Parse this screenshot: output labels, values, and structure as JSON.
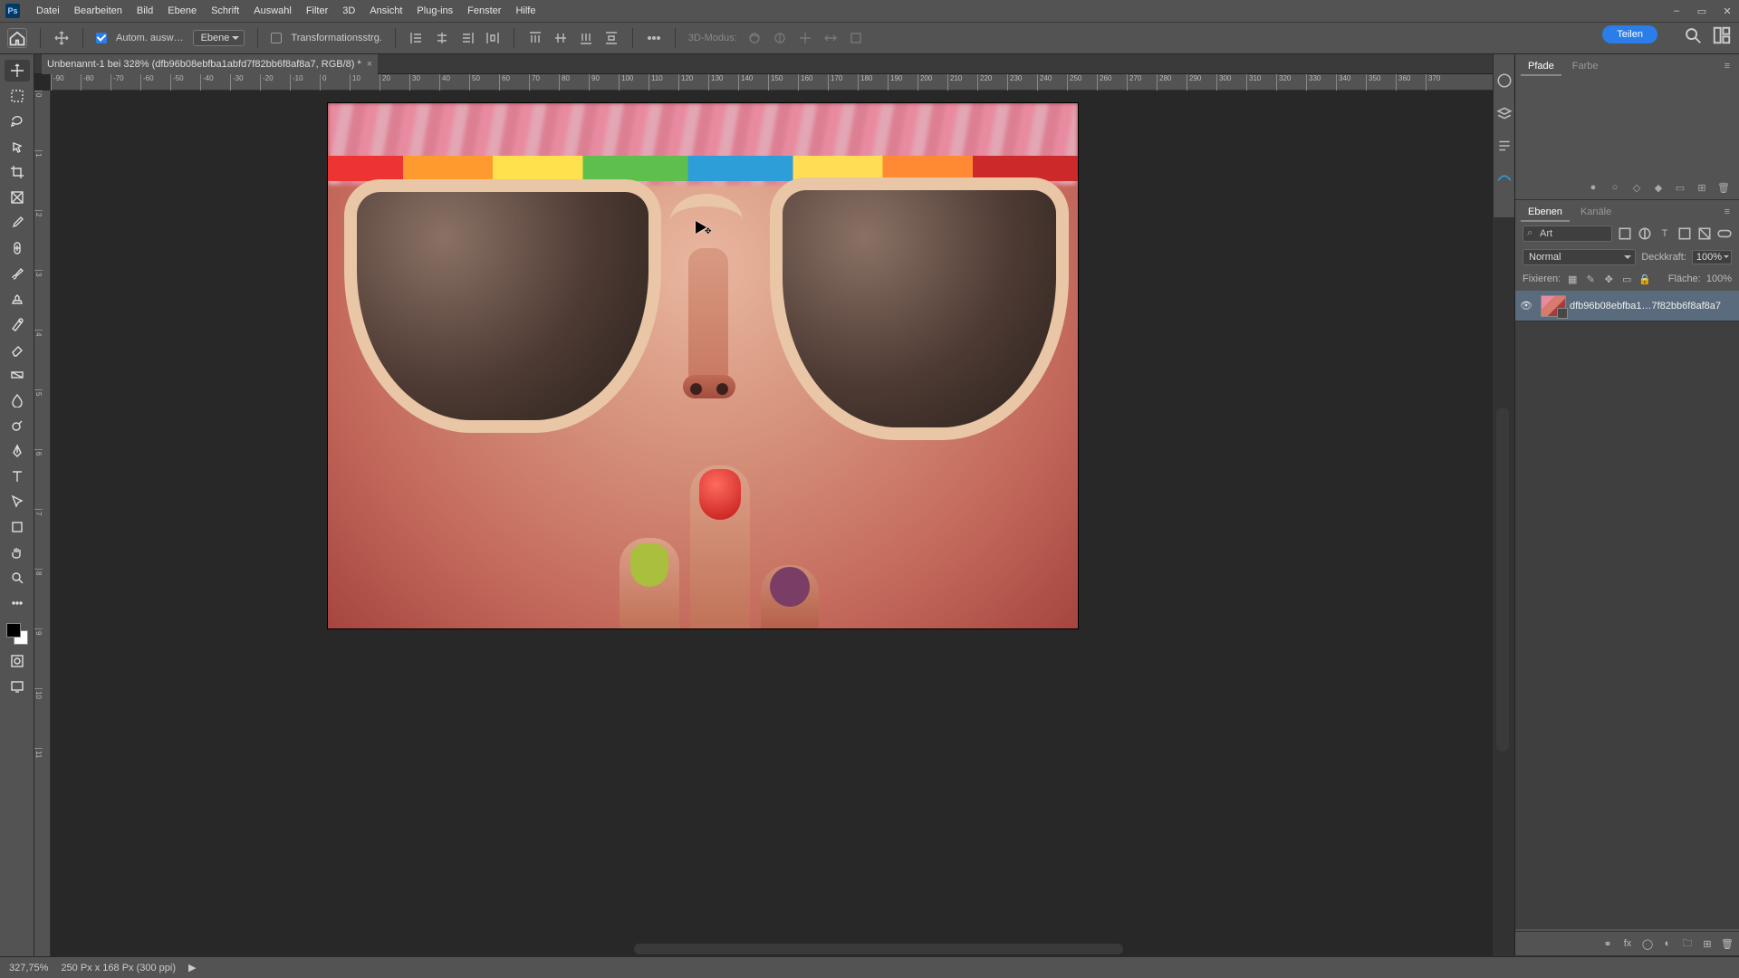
{
  "menu": {
    "items": [
      "Datei",
      "Bearbeiten",
      "Bild",
      "Ebene",
      "Schrift",
      "Auswahl",
      "Filter",
      "3D",
      "Ansicht",
      "Plug-ins",
      "Fenster",
      "Hilfe"
    ]
  },
  "window_controls": {
    "min": "–",
    "max": "▭",
    "close": "✕"
  },
  "options": {
    "auto_select_label": "Autom. ausw…",
    "target_dropdown": "Ebene",
    "transform_label": "Transformationsstrg.",
    "threed_label": "3D-Modus:"
  },
  "share_button": "Teilen",
  "document": {
    "tab_title": "Unbenannt-1 bei 328% (dfb96b08ebfba1abfd7f82bb6f8af8a7, RGB/8) *",
    "tab_close": "×"
  },
  "ruler_h": [
    -90,
    -80,
    -70,
    -60,
    -50,
    -40,
    -30,
    -20,
    -10,
    0,
    10,
    20,
    30,
    40,
    50,
    60,
    70,
    80,
    90,
    100,
    110,
    120,
    130,
    140,
    150,
    160,
    170,
    180,
    190,
    200,
    210,
    220,
    230,
    240,
    250,
    260,
    270,
    280,
    290,
    300,
    310,
    320,
    330,
    340,
    350,
    360,
    370
  ],
  "ruler_v": [
    0,
    1,
    2,
    3,
    4,
    5,
    6,
    7,
    8,
    9,
    10,
    11
  ],
  "panels": {
    "pfade": "Pfade",
    "farbe": "Farbe",
    "ebenen": "Ebenen",
    "kanaele": "Kanäle",
    "filter_mode": "Art",
    "blend_mode": "Normal",
    "opacity_label": "Deckkraft:",
    "opacity_value": "100%",
    "lock_label": "Fixieren:",
    "fill_label": "Fläche:",
    "fill_value": "100%",
    "layer_name": "dfb96b08ebfba1…7f82bb6f8af8a7"
  },
  "status": {
    "zoom": "327,75%",
    "docinfo": "250 Px x 168 Px (300 ppi)",
    "arrow": "▶"
  },
  "colors": {
    "accent": "#2b7de9"
  }
}
